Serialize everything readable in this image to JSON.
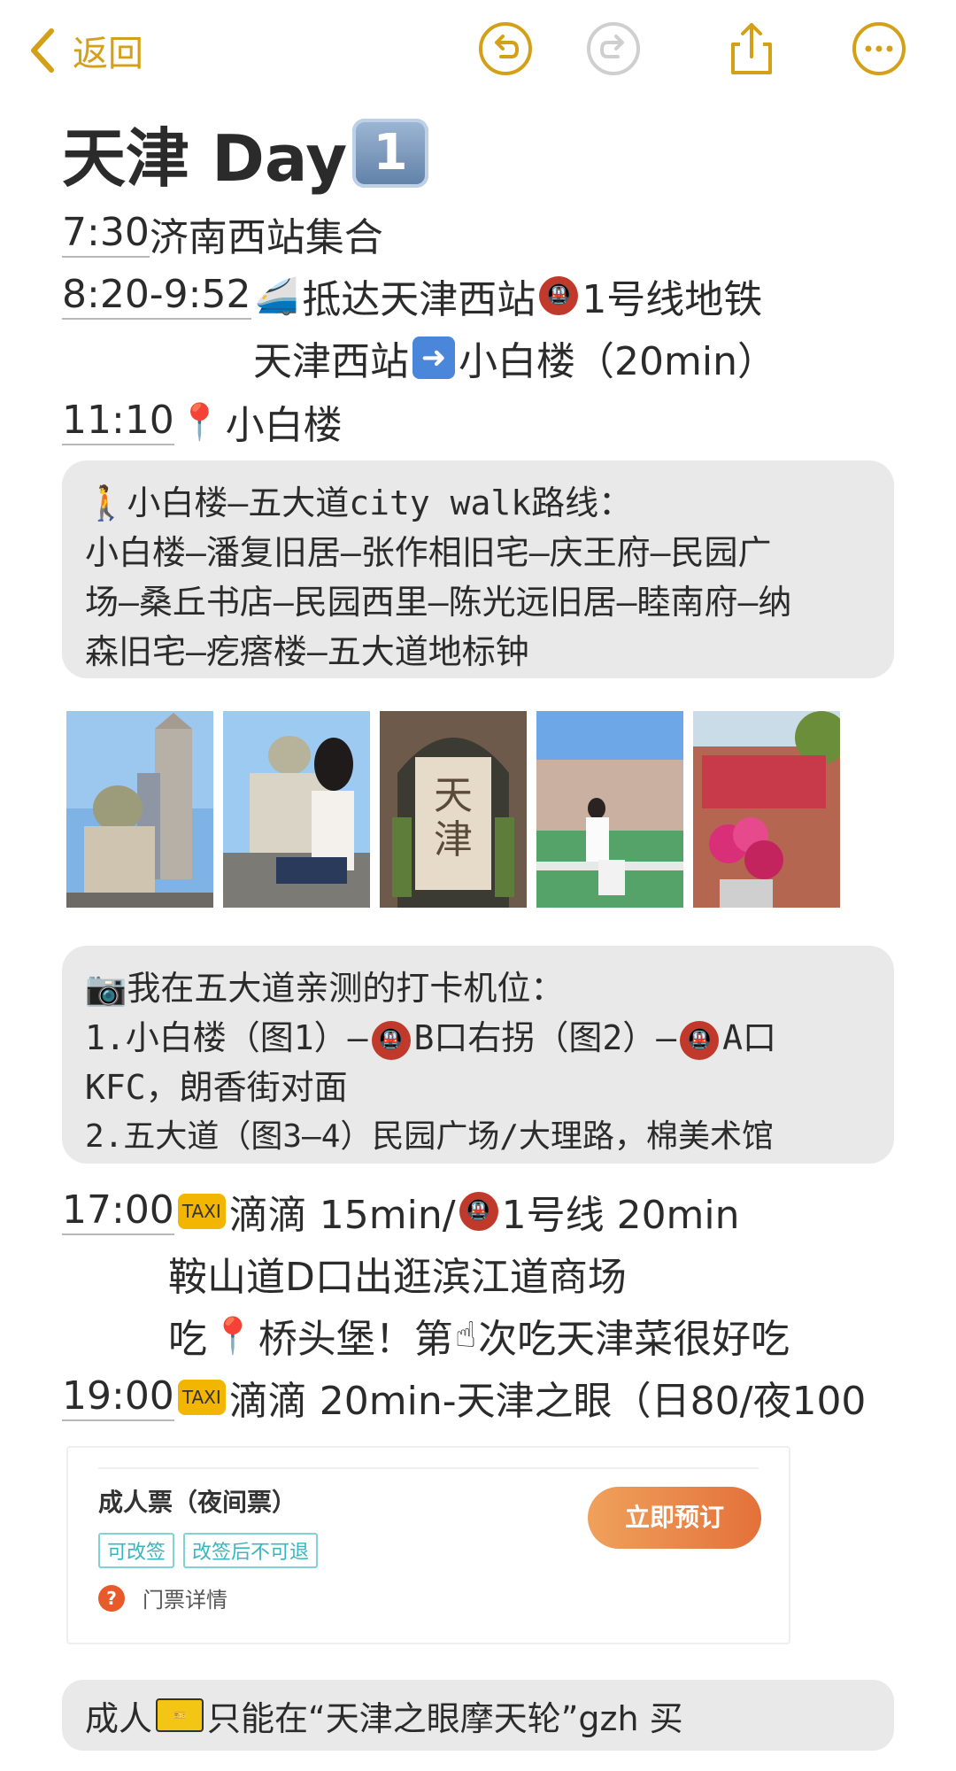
{
  "nav": {
    "back_label": "返回",
    "icons": [
      "undo-icon",
      "redo-icon",
      "share-icon",
      "more-icon"
    ],
    "accent": "#d4a017"
  },
  "note": {
    "title": "天津 Day",
    "title_keycap": "1",
    "lines": {
      "l1": {
        "time": "7:30",
        "text": "济南西站集合"
      },
      "l2": {
        "time": "8:20-9:52",
        "text_a": "抵达天津西站",
        "text_b": "1号线地铁"
      },
      "l3": {
        "text_a": "天津西站",
        "text_b": "小白楼（20min）"
      },
      "l4": {
        "time": "11:10",
        "text": "小白楼"
      }
    },
    "walk_block": {
      "rows": [
        "🚶小白楼–五大道city walk路线：",
        "小白楼–潘复旧居–张作相旧宅–庆王府–民园广",
        "场–桑丘书店–民园西里–陈光远旧居–睦南府–纳",
        "森旧宅–疙瘩楼–五大道地标钟"
      ]
    },
    "photos": [
      "photo-1",
      "photo-2",
      "photo-3",
      "photo-4",
      "photo-5"
    ],
    "spots_block": {
      "r1": "我在五大道亲测的打卡机位：",
      "r2a": "1.小白楼（图1）–",
      "r2b": "B口右拐（图2）–",
      "r2c": "A口",
      "r3": "KFC，朗香街对面",
      "r4": "2.五大道（图3–4）民园广场/大理路，棉美术馆"
    },
    "evening": {
      "l1": {
        "time": "17:00",
        "a": "滴滴 15min/",
        "b": "1号线 20min"
      },
      "l2": "鞍山道D口出逛滨江道商场",
      "l3": {
        "a": "吃",
        "b": "桥头堡！第",
        "c": "次吃天津菜很好吃"
      },
      "l4": {
        "time": "19:00",
        "text": "滴滴 20min-天津之眼（日80/夜100"
      }
    },
    "ticket_card": {
      "title": "成人票（夜间票）",
      "tags": [
        "可改签",
        "改签后不可退"
      ],
      "help": "门票详情",
      "button": "立即预订"
    },
    "bottom_pill": {
      "a": "成人",
      "b": "只能在“天津之眼摩天轮”gzh 买"
    }
  }
}
